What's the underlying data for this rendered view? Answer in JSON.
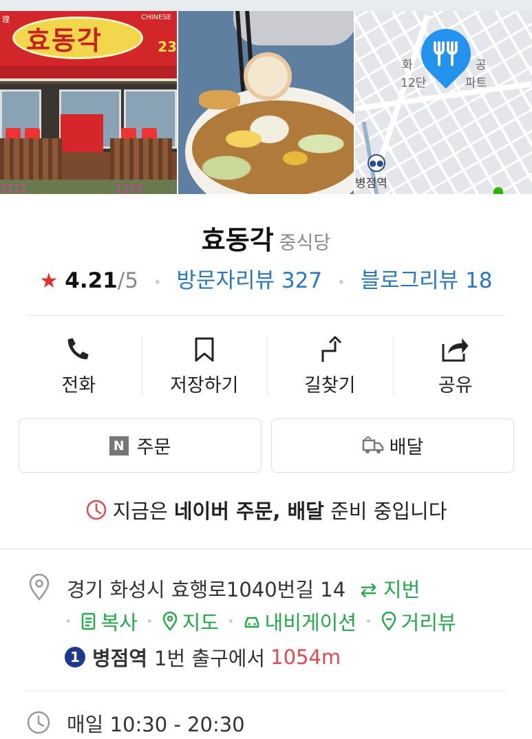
{
  "photos": {
    "storefront": {
      "sign_text": "효동각",
      "sign_small": "CHINESE",
      "sign_number": "23",
      "sign_left_glyph": "理"
    },
    "map": {
      "label_apartment_line1": "화",
      "label_apartment_line1b": "공",
      "label_apartment_line2": "12단",
      "label_apartment_line2b": "파트",
      "label_station": "병점역"
    }
  },
  "place": {
    "name": "효동각",
    "category": "중식당",
    "rating": "4.21",
    "rating_max": "/5",
    "visitor_reviews": "방문자리뷰 327",
    "blog_reviews": "블로그리뷰 18"
  },
  "actions": [
    {
      "label": "전화",
      "icon": "phone-icon"
    },
    {
      "label": "저장하기",
      "icon": "bookmark-icon"
    },
    {
      "label": "길찾기",
      "icon": "directions-icon"
    },
    {
      "label": "공유",
      "icon": "share-icon"
    }
  ],
  "buttons": {
    "order_badge": "N",
    "order_label": "주문",
    "delivery_label": "배달"
  },
  "notice": {
    "prefix": "지금은 ",
    "bold": "네이버 주문, 배달",
    "suffix": " 준비 중입니다"
  },
  "address": {
    "road": "경기 화성시 효행로1040번길 14",
    "toggle": "지번",
    "links": [
      "복사",
      "지도",
      "내비게이션",
      "거리뷰"
    ]
  },
  "transit": {
    "line_number": "1",
    "station": "병점역",
    "exit_text": "1번 출구에서",
    "distance": "1054m"
  },
  "hours": {
    "text": "매일 10:30 - 20:30"
  },
  "colors": {
    "accent_blue": "#2a77c1",
    "star_red": "#e52d2d",
    "green": "#22a94a",
    "distance_red": "#e8464e",
    "line1_blue": "#1d3a8a"
  }
}
